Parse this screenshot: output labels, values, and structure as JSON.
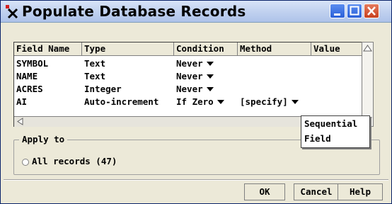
{
  "window": {
    "title": "Populate Database Records"
  },
  "table": {
    "headers": [
      "Field Name",
      "Type",
      "Condition",
      "Method",
      "Value"
    ],
    "rows": [
      {
        "field": "SYMBOL",
        "type": "Text",
        "condition": "Never",
        "method": "",
        "value": ""
      },
      {
        "field": "NAME",
        "type": "Text",
        "condition": "Never",
        "method": "",
        "value": ""
      },
      {
        "field": "ACRES",
        "type": "Integer",
        "condition": "Never",
        "method": "",
        "value": ""
      },
      {
        "field": "AI",
        "type": "Auto-increment",
        "condition": "If Zero",
        "method": "[specify]",
        "value": ""
      }
    ]
  },
  "popup_menu": {
    "items": [
      "Sequential",
      "Field"
    ]
  },
  "apply_to": {
    "legend": "Apply to",
    "option_label": "All records (47)"
  },
  "buttons": {
    "ok": "OK",
    "cancel": "Cancel",
    "help": "Help"
  },
  "icons": {
    "app": "app-icon",
    "minimize": "minimize-icon",
    "maximize": "maximize-icon",
    "close": "close-icon"
  },
  "colors": {
    "title_gradient_top": "#d8e4f8",
    "close_button": "#c8401d",
    "window_bg": "#ece9d8"
  }
}
